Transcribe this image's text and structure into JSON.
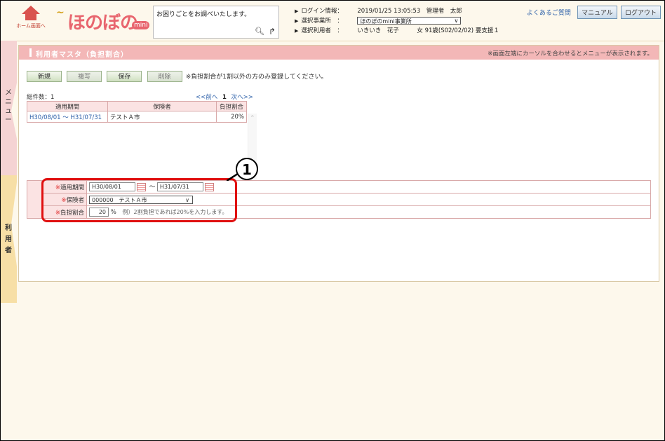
{
  "header": {
    "home_label": "ホーム画面へ",
    "logo_text": "ほのぼの",
    "logo_badge": "mini",
    "help_placeholder": "お困りごとをお調べいたします。",
    "login_label": "ログイン情報：",
    "login_value": "2019/01/25 13:05:53　管理者　太郎",
    "office_label": "選択事業所　：",
    "office_value": "ほのぼのmini事業所",
    "user_label": "選択利用者　：",
    "user_value": "いきいき　花子　　　女 91歳(S02/02/02) 要支援１",
    "faq_link": "よくあるご質問",
    "manual_button": "マニュアル",
    "logout_button": "ログアウト"
  },
  "sidetabs": {
    "menu_label": "メニュー",
    "user_label": "利用者"
  },
  "page": {
    "title": "利用者マスタ（負担割合）",
    "hover_note": "※画面左端にカーソルを合わせるとメニューが表示されます。",
    "buttons": {
      "new": "新規",
      "copy": "複写",
      "save": "保存",
      "delete": "削除"
    },
    "button_note": "※負担割合が1割以外の方のみ登録してください。",
    "total_count": "総件数：1",
    "pager_prev": "<<前へ",
    "pager_current": "1",
    "pager_next": "次へ>>"
  },
  "list": {
    "headers": [
      "適用期間",
      "保険者",
      "負担割合"
    ],
    "rows": [
      {
        "period": "H30/08/01 ～ H31/07/31",
        "insurer": "テストＡ市",
        "ratio": "20%"
      }
    ]
  },
  "form": {
    "period_label": "適用期間",
    "required_mark": "※",
    "period_from": "H30/08/01",
    "period_sep": "～",
    "period_to": "H31/07/31",
    "insurer_label": "保険者",
    "insurer_value": "000000　テストＡ市",
    "ratio_label": "負担割合",
    "ratio_value": "20",
    "ratio_unit": "%",
    "ratio_hint": "例）2割負担であれば20%を入力します。"
  },
  "callout": {
    "number": "1",
    "color": "#e01010"
  }
}
